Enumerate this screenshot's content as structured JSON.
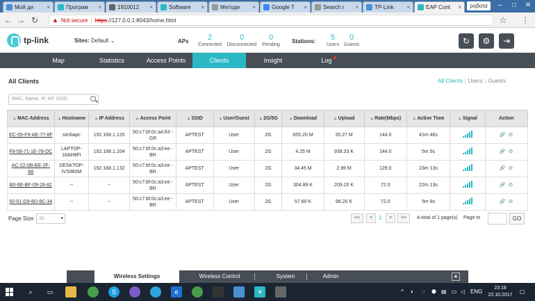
{
  "browser": {
    "tabs": [
      {
        "label": "Мой ди",
        "color": "#4a90d9"
      },
      {
        "label": "Програм",
        "color": "#2bb8c4"
      },
      {
        "label": "1910012",
        "color": "#666666"
      },
      {
        "label": "Software",
        "color": "#2bb8c4"
      },
      {
        "label": "Методи",
        "color": "#999999"
      },
      {
        "label": "Google T",
        "color": "#4285f4"
      },
      {
        "label": "Search r",
        "color": "#999999"
      },
      {
        "label": "TP-Link",
        "color": "#4a90d9"
      },
      {
        "label": "EAP Cont",
        "color": "#2bb8c4"
      }
    ],
    "user_badge": "ροβοτα",
    "not_secure": "Not secure",
    "url_https": "https",
    "url_rest": "://127.0.0.1:8043/home.html"
  },
  "header": {
    "logo_text": "tp-link",
    "sites_label": "Sites:",
    "sites_value": "Default",
    "aps_label": "APs",
    "aps_connected": "2",
    "aps_connected_cap": "Connected",
    "aps_disconnected": "0",
    "aps_disconnected_cap": "Disconnected",
    "aps_pending": "0",
    "aps_pending_cap": "Pending",
    "stations_label": "Stations:",
    "stations_users": "5",
    "stations_users_cap": "Users",
    "stations_guests": "0",
    "stations_guests_cap": "Guests"
  },
  "nav": {
    "tabs": [
      "Map",
      "Statistics",
      "Access Points",
      "Clients",
      "Insight",
      "Log"
    ]
  },
  "main": {
    "title": "All Clients",
    "filter_all": "All Clients",
    "filter_users": "Users",
    "filter_guests": "Guests",
    "search_placeholder": "MAC, Name, IP, AP, SSID"
  },
  "table": {
    "columns": [
      "MAC Address",
      "Hostname",
      "IP Address",
      "Access Point",
      "SSID",
      "User/Guest",
      "2G/5G",
      "Download",
      "Upload",
      "Rate(Mbps)",
      "Active Time",
      "Signal",
      "Action"
    ],
    "rows": [
      {
        "mac": "EC-55-F9-AE-77-8F",
        "host": "simbapc",
        "ip": "192.168.1.125",
        "ap": "50:c7:bf:0c:a4:83 - GR",
        "ssid": "APTEST",
        "type": "User",
        "band": "2G",
        "down": "655.20 M",
        "up": "35.27 M",
        "rate": "144.0",
        "time": "41m 46s",
        "signal": 5
      },
      {
        "mac": "F8-59-71-1E-78-DC",
        "host": "LAPTOP-16AH8FI",
        "ip": "192.168.1.104",
        "ap": "50:c7:bf:0c:a3:ee - BR",
        "ssid": "APTEST",
        "type": "User",
        "band": "2G",
        "down": "4.25 M",
        "up": "939.33 K",
        "rate": "144.0",
        "time": "5m 5s",
        "signal": 5
      },
      {
        "mac": "AC-22-0B-BE-2F-8A",
        "host": "DESKTOP-IVS980M",
        "ip": "192.168.1.132",
        "ap": "50:c7:bf:0c:a3:ee - BR",
        "ssid": "APTEST",
        "type": "User",
        "band": "2G",
        "down": "34.45 M",
        "up": "2.96 M",
        "rate": "129.0",
        "time": "23m 13s",
        "signal": 5
      },
      {
        "mac": "B0-6E-BF-09-28-82",
        "host": "--",
        "ip": "--",
        "ap": "50:c7:bf:0c:a3:ee - BR",
        "ssid": "APTEST",
        "type": "User",
        "band": "2G",
        "down": "304.89 K",
        "up": "209.20 K",
        "rate": "72.0",
        "time": "22m 13s",
        "signal": 5
      },
      {
        "mac": "50-01-D9-8D-8C-34",
        "host": "--",
        "ip": "--",
        "ap": "50:c7:bf:0c:a3:ee - BR",
        "ssid": "APTEST",
        "type": "User",
        "band": "2G",
        "down": "57.60 K",
        "up": "98.20 K",
        "rate": "72.0",
        "time": "5m 9s",
        "signal": 5
      }
    ]
  },
  "pager": {
    "page_size_label": "Page Size",
    "page_size": "10",
    "first": "<<",
    "prev": "<",
    "current": "1",
    "next": ">",
    "last": ">>",
    "total": "A total of 1 page(s)",
    "goto_label": "Page to",
    "go": "GO"
  },
  "bottom": {
    "items": [
      "Wireless Settings",
      "Wireless Control",
      "System",
      "Admin"
    ]
  },
  "taskbar": {
    "lang": "ENG",
    "time": "23:18",
    "date": "22.10.2017"
  },
  "colors": {
    "accent": "#2bb8c4",
    "nav_bg": "#474e56"
  }
}
